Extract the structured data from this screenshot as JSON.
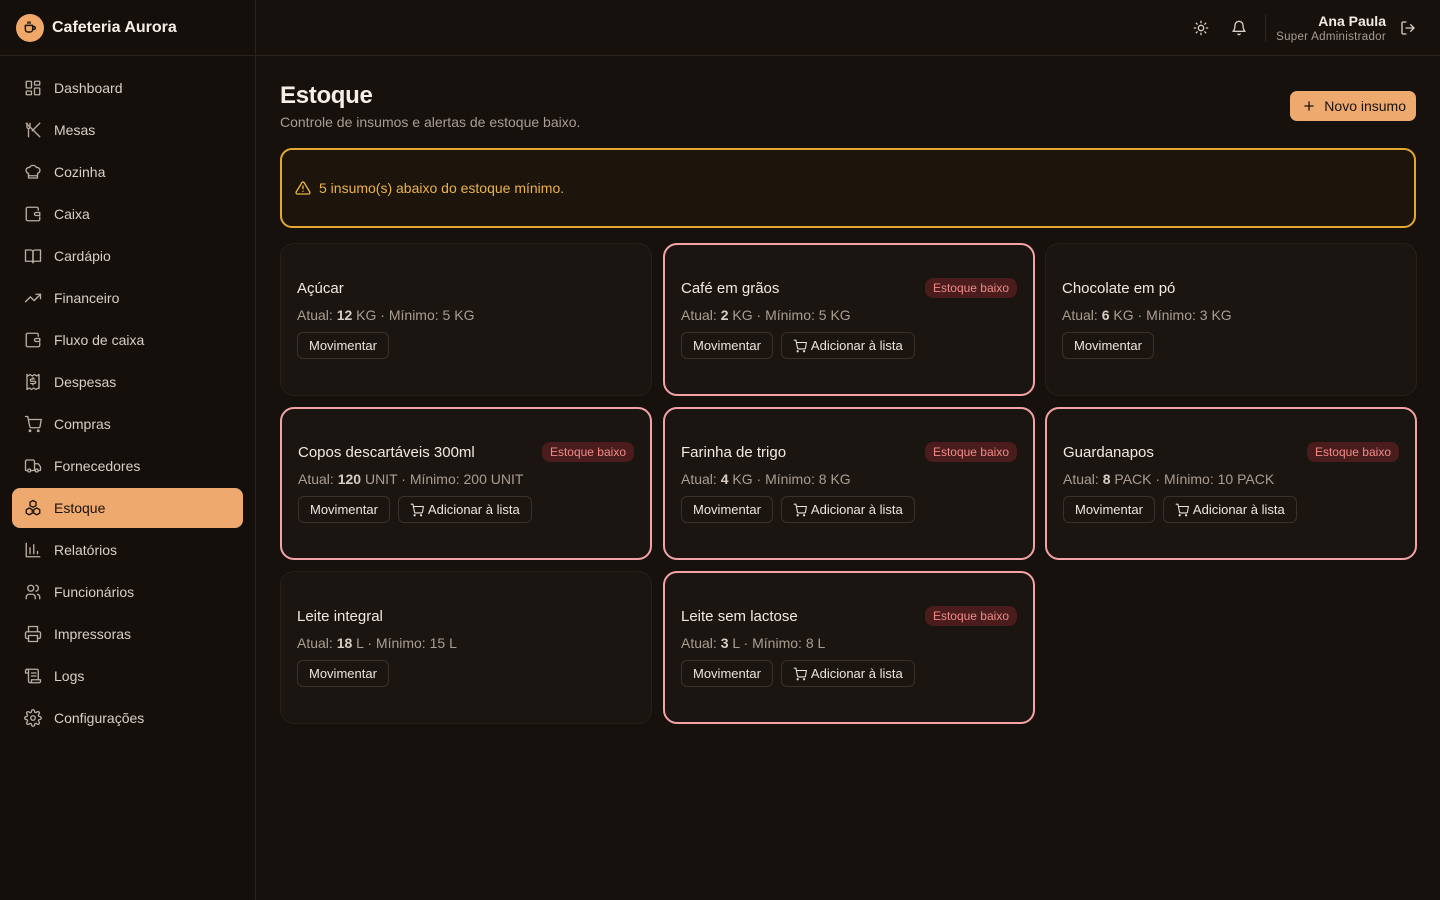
{
  "brand": {
    "name": "Cafeteria Aurora"
  },
  "nav": [
    {
      "label": "Dashboard",
      "icon": "dashboard-icon",
      "active": false
    },
    {
      "label": "Mesas",
      "icon": "utensils-icon",
      "active": false
    },
    {
      "label": "Cozinha",
      "icon": "chef-hat-icon",
      "active": false
    },
    {
      "label": "Caixa",
      "icon": "wallet-icon",
      "active": false
    },
    {
      "label": "Cardápio",
      "icon": "book-icon",
      "active": false
    },
    {
      "label": "Financeiro",
      "icon": "trending-up-icon",
      "active": false
    },
    {
      "label": "Fluxo de caixa",
      "icon": "wallet-icon",
      "active": false
    },
    {
      "label": "Despesas",
      "icon": "receipt-icon",
      "active": false
    },
    {
      "label": "Compras",
      "icon": "cart-icon",
      "active": false
    },
    {
      "label": "Fornecedores",
      "icon": "truck-icon",
      "active": false
    },
    {
      "label": "Estoque",
      "icon": "boxes-icon",
      "active": true
    },
    {
      "label": "Relatórios",
      "icon": "bar-chart-icon",
      "active": false
    },
    {
      "label": "Funcionários",
      "icon": "users-icon",
      "active": false
    },
    {
      "label": "Impressoras",
      "icon": "printer-icon",
      "active": false
    },
    {
      "label": "Logs",
      "icon": "scroll-icon",
      "active": false
    },
    {
      "label": "Configurações",
      "icon": "gear-icon",
      "active": false
    }
  ],
  "topbar": {
    "user_name": "Ana Paula",
    "user_role": "Super Administrador"
  },
  "page": {
    "title": "Estoque",
    "subtitle": "Controle de insumos e alertas de estoque baixo.",
    "new_button": "Novo insumo"
  },
  "alert": {
    "text": "5 insumo(s) abaixo do estoque mínimo."
  },
  "labels": {
    "current": "Atual:",
    "minimum": "Mínimo:",
    "move": "Movimentar",
    "add_to_list": "Adicionar à lista",
    "low_stock": "Estoque baixo"
  },
  "items": [
    {
      "name": "Açúcar",
      "current": "12",
      "min": "5",
      "unit": "KG",
      "low": false
    },
    {
      "name": "Café em grãos",
      "current": "2",
      "min": "5",
      "unit": "KG",
      "low": true
    },
    {
      "name": "Chocolate em pó",
      "current": "6",
      "min": "3",
      "unit": "KG",
      "low": false
    },
    {
      "name": "Copos descartáveis 300ml",
      "current": "120",
      "min": "200",
      "unit": "UNIT",
      "low": true
    },
    {
      "name": "Farinha de trigo",
      "current": "4",
      "min": "8",
      "unit": "KG",
      "low": true
    },
    {
      "name": "Guardanapos",
      "current": "8",
      "min": "10",
      "unit": "PACK",
      "low": true
    },
    {
      "name": "Leite integral",
      "current": "18",
      "min": "15",
      "unit": "L",
      "low": false
    },
    {
      "name": "Leite sem lactose",
      "current": "3",
      "min": "8",
      "unit": "L",
      "low": true
    }
  ],
  "colors": {
    "accent": "#eeaa6e",
    "alert": "#e3a82f",
    "low_border": "#f3a3a6",
    "badge_bg": "#4a1c1c",
    "badge_text": "#f08b8b"
  }
}
